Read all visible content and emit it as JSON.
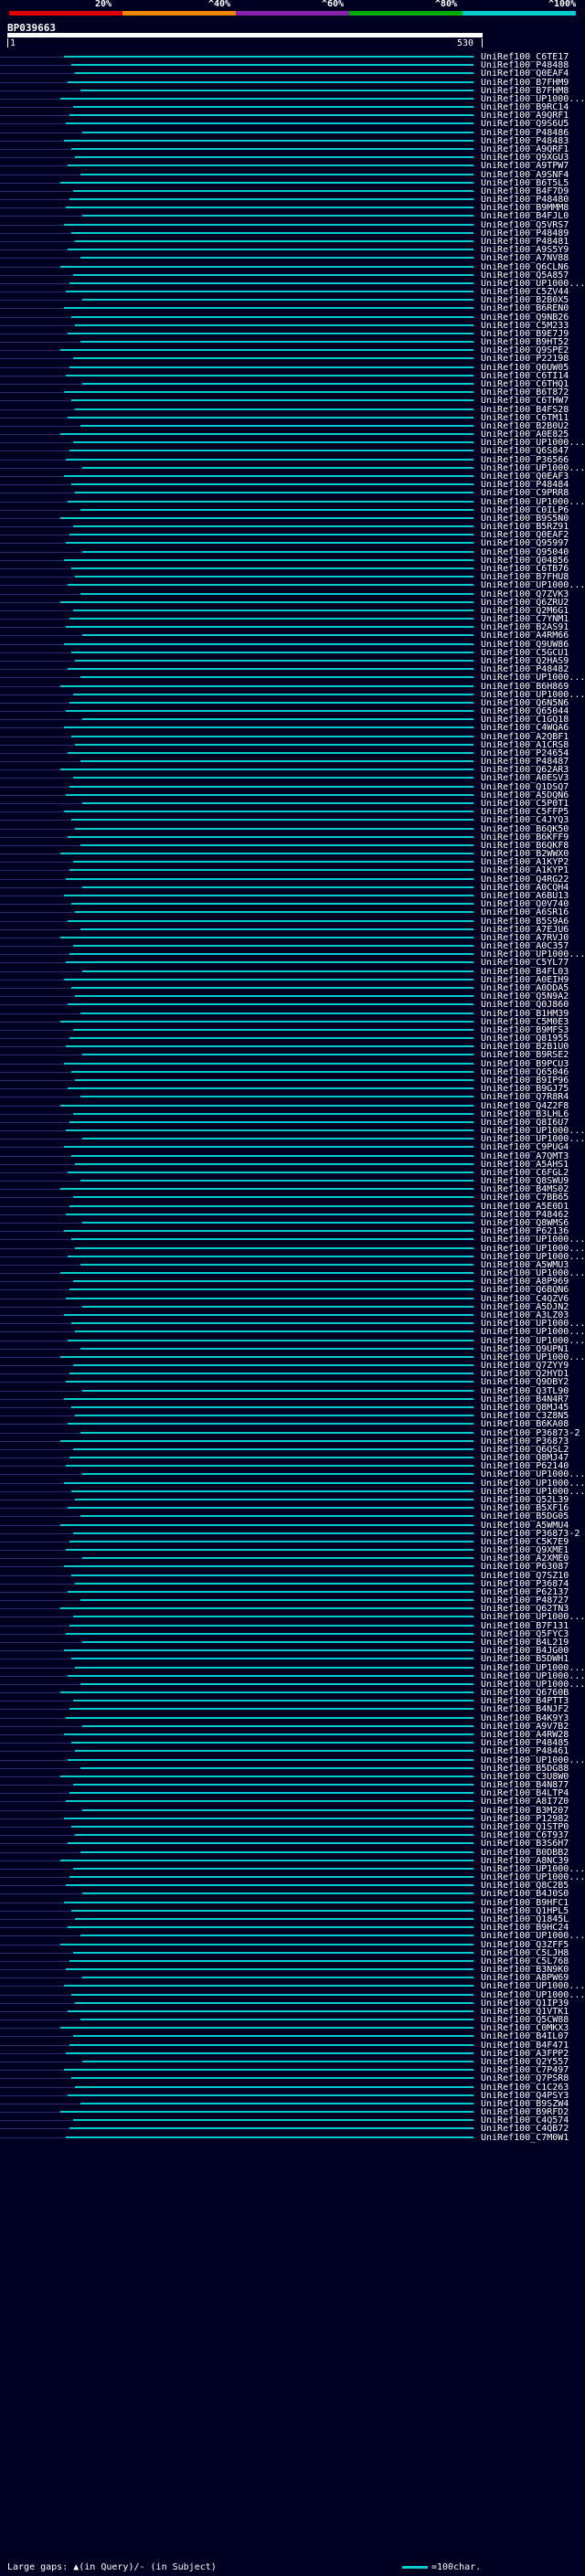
{
  "legend": {
    "labels": [
      "20%",
      "^40%",
      "^60%",
      "^80%",
      "^100%"
    ],
    "colors": [
      "#dd0000",
      "#ee8800",
      "#8822aa",
      "#00aa00",
      "#00cccc"
    ]
  },
  "query": {
    "id": "BP039663",
    "start_label": "1",
    "end_label": "530"
  },
  "hits": [
    "UniRef100_C6TE17",
    "UniRef100_P48488",
    "UniRef100_Q0EAF4",
    "UniRef100_B7FHM9",
    "UniRef100_B7FHM8",
    "UniRef100_UP1000...",
    "UniRef100_B9RC14",
    "UniRef100_A9QRF1",
    "UniRef100_Q9S6U5",
    "UniRef100_P48486",
    "UniRef100_P48483",
    "UniRef100_A9QRF1",
    "UniRef100_Q9XGU3",
    "UniRef100_A9TPW7",
    "UniRef100_A9SNF4",
    "UniRef100_B6T5L5",
    "UniRef100_B4F7D9",
    "UniRef100_P48480",
    "UniRef100_B9MMM8",
    "UniRef100_B4FJL0",
    "UniRef100_Q5VRS7",
    "UniRef100_P48489",
    "UniRef100_P48481",
    "UniRef100_A9S5Y9",
    "UniRef100_A7NV88",
    "UniRef100_Q6CLN6",
    "UniRef100_Q5A857",
    "UniRef100_UP1000...",
    "UniRef100_C5ZV44",
    "UniRef100_B2B0X5",
    "UniRef100_B6REN0",
    "UniRef100_Q9NB26",
    "UniRef100_C5M233",
    "UniRef100_B9E7J9",
    "UniRef100_B9HT52",
    "UniRef100_Q9SPE2",
    "UniRef100_P22198",
    "UniRef100_Q0UW05",
    "UniRef100_C6TI14",
    "UniRef100_C6THQ1",
    "UniRef100_B6T872",
    "UniRef100_C6THW7",
    "UniRef100_B4FS28",
    "UniRef100_C6TM11",
    "UniRef100_B2B0U2",
    "UniRef100_A0E825",
    "UniRef100_UP1000...",
    "UniRef100_Q6S847",
    "UniRef100_P36566",
    "UniRef100_UP1000...",
    "UniRef100_Q0EAF3",
    "UniRef100_P48484",
    "UniRef100_C9PRR8",
    "UniRef100_UP1000...",
    "UniRef100_C0ILP6",
    "UniRef100_B9S5N0",
    "UniRef100_B5RZ91",
    "UniRef100_Q0EAF2",
    "UniRef100_Q95997",
    "UniRef100_Q95040",
    "UniRef100_Q04856",
    "UniRef100_C6TB76",
    "UniRef100_B7FHU8",
    "UniRef100_UP1000...",
    "UniRef100_Q7ZVK3",
    "UniRef100_Q6ZRU2",
    "UniRef100_Q2M6G1",
    "UniRef100_C7YNM1",
    "UniRef100_B2AS91",
    "UniRef100_A4RM66",
    "UniRef100_Q9UW86",
    "UniRef100_C5GCU1",
    "UniRef100_Q2HAS9",
    "UniRef100_P48482",
    "UniRef100_UP1000...",
    "UniRef100_B6H869",
    "UniRef100_UP1000...",
    "UniRef100_Q6N5N6",
    "UniRef100_Q65044",
    "UniRef100_C1GQ18",
    "UniRef100_C4WQA6",
    "UniRef100_A2QBF1",
    "UniRef100_A1CRS8",
    "UniRef100_P24654",
    "UniRef100_P48487",
    "UniRef100_Q62AR3",
    "UniRef100_A0ESV3",
    "UniRef100_Q1DSQ7",
    "UniRef100_A5DQN6",
    "UniRef100_C5P0T1",
    "UniRef100_C5FFP5",
    "UniRef100_C4JYQ3",
    "UniRef100_B6QK50",
    "UniRef100_B6KFF9",
    "UniRef100_B6QKF8",
    "UniRef100_B2WWX0",
    "UniRef100_A1KYP2",
    "UniRef100_A1KYP1",
    "UniRef100_Q4RG22",
    "UniRef100_A0CQH4",
    "UniRef100_A6BU13",
    "UniRef100_Q0V740",
    "UniRef100_A6SR16",
    "UniRef100_B5S9A6",
    "UniRef100_A7EJU6",
    "UniRef100_A7RVJ0",
    "UniRef100_A0C357",
    "UniRef100_UP1000...",
    "UniRef100_C5YL77",
    "UniRef100_B4FL03",
    "UniRef100_A0EIH9",
    "UniRef100_A0DDA5",
    "UniRef100_Q5N9A2",
    "UniRef100_Q0J860",
    "UniRef100_B1HM39",
    "UniRef100_C5M0E3",
    "UniRef100_B9MFS3",
    "UniRef100_Q81955",
    "UniRef100_B2B1U0",
    "UniRef100_B9RSE2",
    "UniRef100_B9PCU3",
    "UniRef100_Q65046",
    "UniRef100_B9IP96",
    "UniRef100_B9GJ75",
    "UniRef100_Q7R8R4",
    "UniRef100_Q4Z2F8",
    "UniRef100_B3LHL6",
    "UniRef100_Q8I6U7",
    "UniRef100_UP1000...",
    "UniRef100_UP1000...",
    "UniRef100_C9PUG4",
    "UniRef100_A7QMT3",
    "UniRef100_A5AHS1",
    "UniRef100_C6FGL2",
    "UniRef100_Q8SWU9",
    "UniRef100_B4MS02",
    "UniRef100_C7BB65",
    "UniRef100_A5E0D1",
    "UniRef100_P48462",
    "UniRef100_Q8WMS6",
    "UniRef100_P62136",
    "UniRef100_UP1000...",
    "UniRef100_UP1000...",
    "UniRef100_UP1000...",
    "UniRef100_A5WMU3",
    "UniRef100_UP1000...",
    "UniRef100_A8P969",
    "UniRef100_Q6BQN6",
    "UniRef100_C4QZV6",
    "UniRef100_A5DJN2",
    "UniRef100_A3LZ03",
    "UniRef100_UP1000...",
    "UniRef100_UP1000...",
    "UniRef100_UP1000...",
    "UniRef100_Q9UPN1",
    "UniRef100_UP1000...",
    "UniRef100_Q7ZYY9",
    "UniRef100_Q2HYD1",
    "UniRef100_Q9DBY2",
    "UniRef100_Q3TL90",
    "UniRef100_B4N4R7",
    "UniRef100_Q8MJ45",
    "UniRef100_C3Z8N5",
    "UniRef100_B6KA08",
    "UniRef100_P36873-2",
    "UniRef100_P36873",
    "UniRef100_Q6QSL2",
    "UniRef100_Q8MJ47",
    "UniRef100_P62140",
    "UniRef100_UP1000...",
    "UniRef100_UP1000...",
    "UniRef100_UP1000...",
    "UniRef100_Q52L39",
    "UniRef100_B5XF16",
    "UniRef100_B5DG05",
    "UniRef100_A5WMU4",
    "UniRef100_P36873-2",
    "UniRef100_C5K7E9",
    "UniRef100_Q9XME1",
    "UniRef100_A2XME0",
    "UniRef100_P63087",
    "UniRef100_Q7SZ10",
    "UniRef100_P36874",
    "UniRef100_P62137",
    "UniRef100_P48727",
    "UniRef100_Q62TN3",
    "UniRef100_UP1000...",
    "UniRef100_B7F131",
    "UniRef100_Q5FYC3",
    "UniRef100_B4L219",
    "UniRef100_B4JG00",
    "UniRef100_B5DWH1",
    "UniRef100_UP1000...",
    "UniRef100_UP1000...",
    "UniRef100_UP1000...",
    "UniRef100_Q6760B",
    "UniRef100_B4PTT3",
    "UniRef100_B4NJF2",
    "UniRef100_B4K9Y3",
    "UniRef100_A9V7B2",
    "UniRef100_A4RW28",
    "UniRef100_P48485",
    "UniRef100_P48461",
    "UniRef100_UP1000...",
    "UniRef100_B5DG88",
    "UniRef100_C3U8W0",
    "UniRef100_B4N877",
    "UniRef100_B4LTP4",
    "UniRef100_A8I7Z0",
    "UniRef100_B3M207",
    "UniRef100_P12982",
    "UniRef100_Q1STP0",
    "UniRef100_C6T937",
    "UniRef100_B3S6H7",
    "UniRef100_B0DBB2",
    "UniRef100_A8NC39",
    "UniRef100_UP1000...",
    "UniRef100_UP1000...",
    "UniRef100_Q8C2B5",
    "UniRef100_B4J0S0",
    "UniRef100_B9HFC1",
    "UniRef100_Q1HPL5",
    "UniRef100_Q1845L",
    "UniRef100_B9HC24",
    "UniRef100_UP1000...",
    "UniRef100_Q3ZFF5",
    "UniRef100_C5LJH8",
    "UniRef100_C5L768",
    "UniRef100_B3N9K0",
    "UniRef100_A8PW69",
    "UniRef100_UP1000...",
    "UniRef100_UP1000...",
    "UniRef100_Q1IP39",
    "UniRef100_Q1VTK1",
    "UniRef100_Q5CW88",
    "UniRef100_C0MKX3",
    "UniRef100_B4IL07",
    "UniRef100_B4F471",
    "UniRef100_A3FPP2",
    "UniRef100_Q2Y557",
    "UniRef100_C7P497",
    "UniRef100_Q7PSR8",
    "UniRef100_C1C263",
    "UniRef100_Q4PSY3",
    "UniRef100_B9SZW4",
    "UniRef100_B9RFD2",
    "UniRef100_C4Q574",
    "UniRef100_C4QB72",
    "UniRef100_C7M0W1"
  ],
  "footer": {
    "gaps_label": "Large gaps: ▲(in Query)/- (in Subject)",
    "scale_label": "=100char."
  }
}
